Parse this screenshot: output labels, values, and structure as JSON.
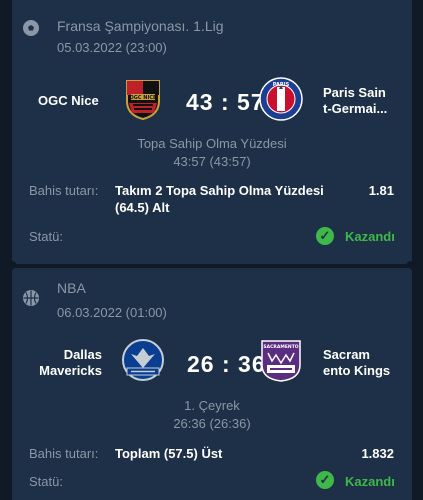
{
  "match1": {
    "league": "Fransa Şampiyonası. 1.Lig",
    "date": "05.03.2022 (23:00)",
    "home_team": "OGC Nice",
    "away_team_line1": "Paris Sain",
    "away_team_line2": "t-Germai...",
    "score": "43 : 57",
    "stat_label": "Topa Sahip Olma Yüzdesi",
    "stat_value": "43:57 (43:57)",
    "bet_label": "Bahis tutarı:",
    "bet_line1": "Takım 2 Topa Sahip Olma Yüzdesi",
    "bet_line2": "(64.5) Alt",
    "odds": "1.81",
    "status_label": "Statü:",
    "status": "Kazandı",
    "home_logo_text": "OGC NICE",
    "away_logo_text": "PARIS"
  },
  "match2": {
    "league": "NBA",
    "date": "06.03.2022 (01:00)",
    "home_team_line1": "Dallas",
    "home_team_line2": "Mavericks",
    "away_team_line1": "Sacram",
    "away_team_line2": "ento Kings",
    "score": "26 : 36",
    "period": "1. Çeyrek",
    "period_score": "26:36 (26:36)",
    "bet_label": "Bahis tutarı:",
    "bet": "Toplam (57.5) Üst",
    "odds": "1.832",
    "status_label": "Statü:",
    "status": "Kazandı",
    "away_logo_text": "SACRAMENTO"
  },
  "icons": {
    "league1": "soccer-ball-icon",
    "league2": "basketball-icon",
    "status": "check-circle-icon"
  },
  "colors": {
    "background": "#101a27",
    "card": "#1d3047",
    "muted_text": "#8b97a6",
    "won": "#3fb84a"
  }
}
